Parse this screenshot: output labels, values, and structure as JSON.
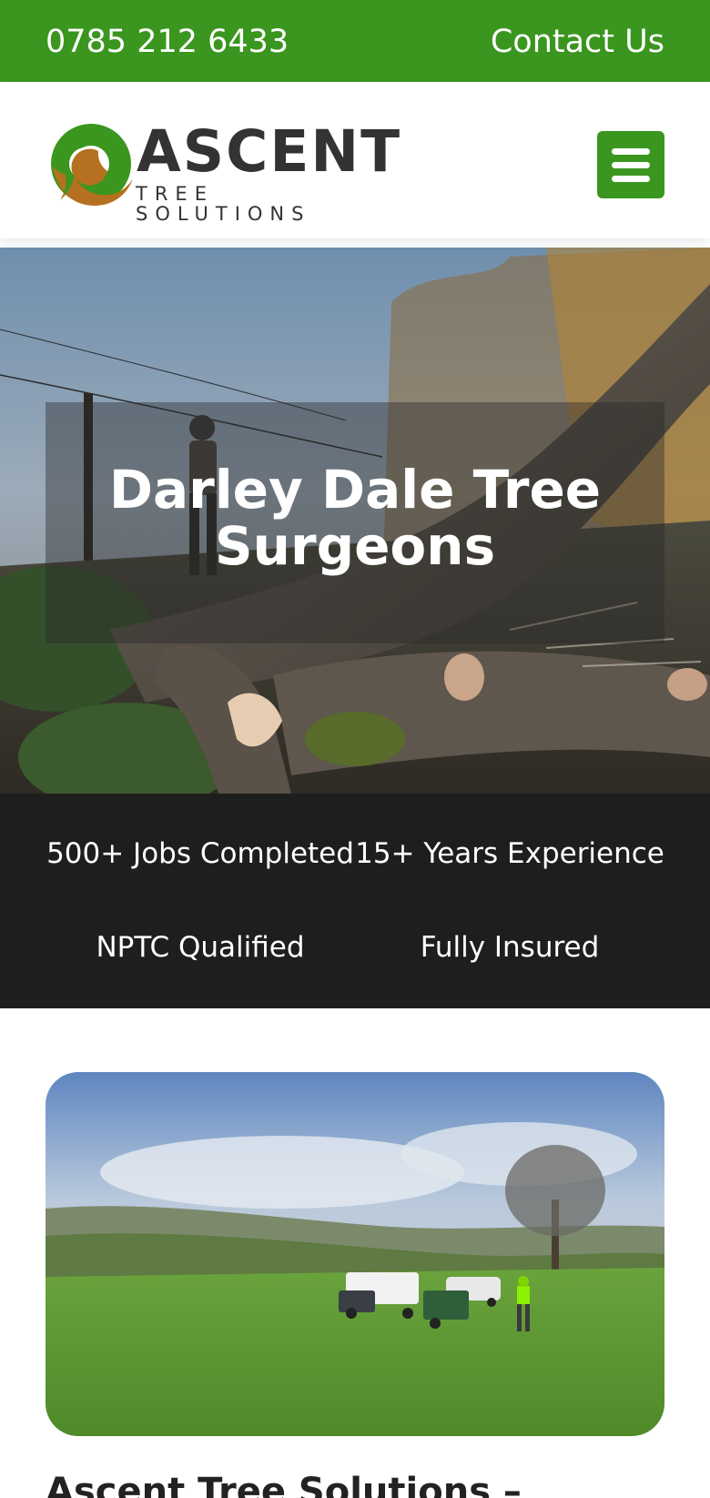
{
  "topbar": {
    "phone": "0785 212 6433",
    "contact_label": "Contact Us"
  },
  "logo": {
    "wordmark": "ASCENT",
    "tagline": "TREE SOLUTIONS"
  },
  "menu": {
    "icon": "hamburger-menu-icon"
  },
  "hero": {
    "title": "Darley Dale Tree Surgeons"
  },
  "stats": [
    {
      "label": "500+ Jobs Completed"
    },
    {
      "label": "15+ Years Experience"
    },
    {
      "label": "NPTC Qualified"
    },
    {
      "label": "Fully Insured"
    }
  ],
  "section": {
    "heading": "Ascent Tree Solutions –"
  },
  "colors": {
    "brand_green": "#3a961e",
    "logo_brown": "#b5711f",
    "stats_background": "#1e1e1e",
    "text_dark": "#333333"
  }
}
